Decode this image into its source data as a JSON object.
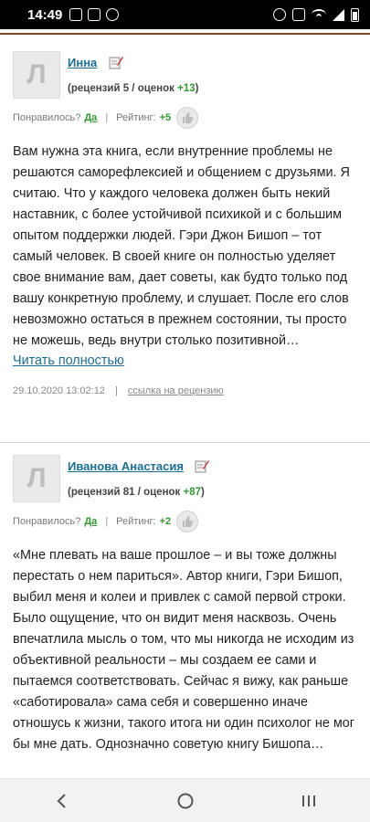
{
  "status_bar": {
    "time": "14:49",
    "left_icons": [
      "image-icon",
      "mail-icon",
      "whatsapp-icon"
    ],
    "right_icons": [
      "alarm-icon",
      "mute-icon",
      "wifi-icon",
      "signal-icon",
      "battery-icon"
    ]
  },
  "reviews": [
    {
      "author": "Инна",
      "avatar_letter": "Л",
      "stats_prefix": "(рецензий 5 / оценок ",
      "stats_score": "+13",
      "stats_suffix": ")",
      "liked_label": "Понравилось?",
      "liked_yes": "Да",
      "rating_label": "Рейтинг:",
      "rating_value": "+5",
      "text": "Вам нужна эта книга, если внутренние проблемы не решаются саморефлексией и общением с друзьями. Я считаю. Что у каждого человека должен быть некий наставник, с более устойчивой психикой и с большим опытом поддержки людей. Гэри Джон Бишоп – тот самый человек. В своей книге он полностью уделяет свое внимание вам, дает советы, как будто только под вашу конкретную проблему, и слушает. После его слов невозможно остаться в прежнем состоянии, ты просто не можешь, ведь внутри столько позитивной…",
      "read_more": "Читать полностью",
      "date": "29.10.2020 13:02:12",
      "link": "ссылка на рецензию"
    },
    {
      "author": "Иванова Анастасия",
      "avatar_letter": "Л",
      "stats_prefix": "(рецензий 81 / оценок ",
      "stats_score": "+87",
      "stats_suffix": ")",
      "liked_label": "Понравилось?",
      "liked_yes": "Да",
      "rating_label": "Рейтинг:",
      "rating_value": "+2",
      "text": "«Мне плевать на ваше прошлое – и вы тоже должны перестать о нем париться». Автор книги, Гэри Бишоп, выбил меня и колеи и привлек с самой первой строки. Было ощущение, что он видит меня насквозь. Очень впечатлила мысль о том, что мы никогда не исходим из объективной реальности – мы создаем ее сами и пытаемся соответствовать. Сейчас я вижу, как раньше «саботировала» сама себя и совершенно иначе отношусь к жизни, такого итога ни один психолог не мог бы мне дать. Однозначно советую книгу Бишопа…"
    }
  ],
  "nav_bar": {
    "back": "‹",
    "home": "○",
    "recents": "|||"
  }
}
